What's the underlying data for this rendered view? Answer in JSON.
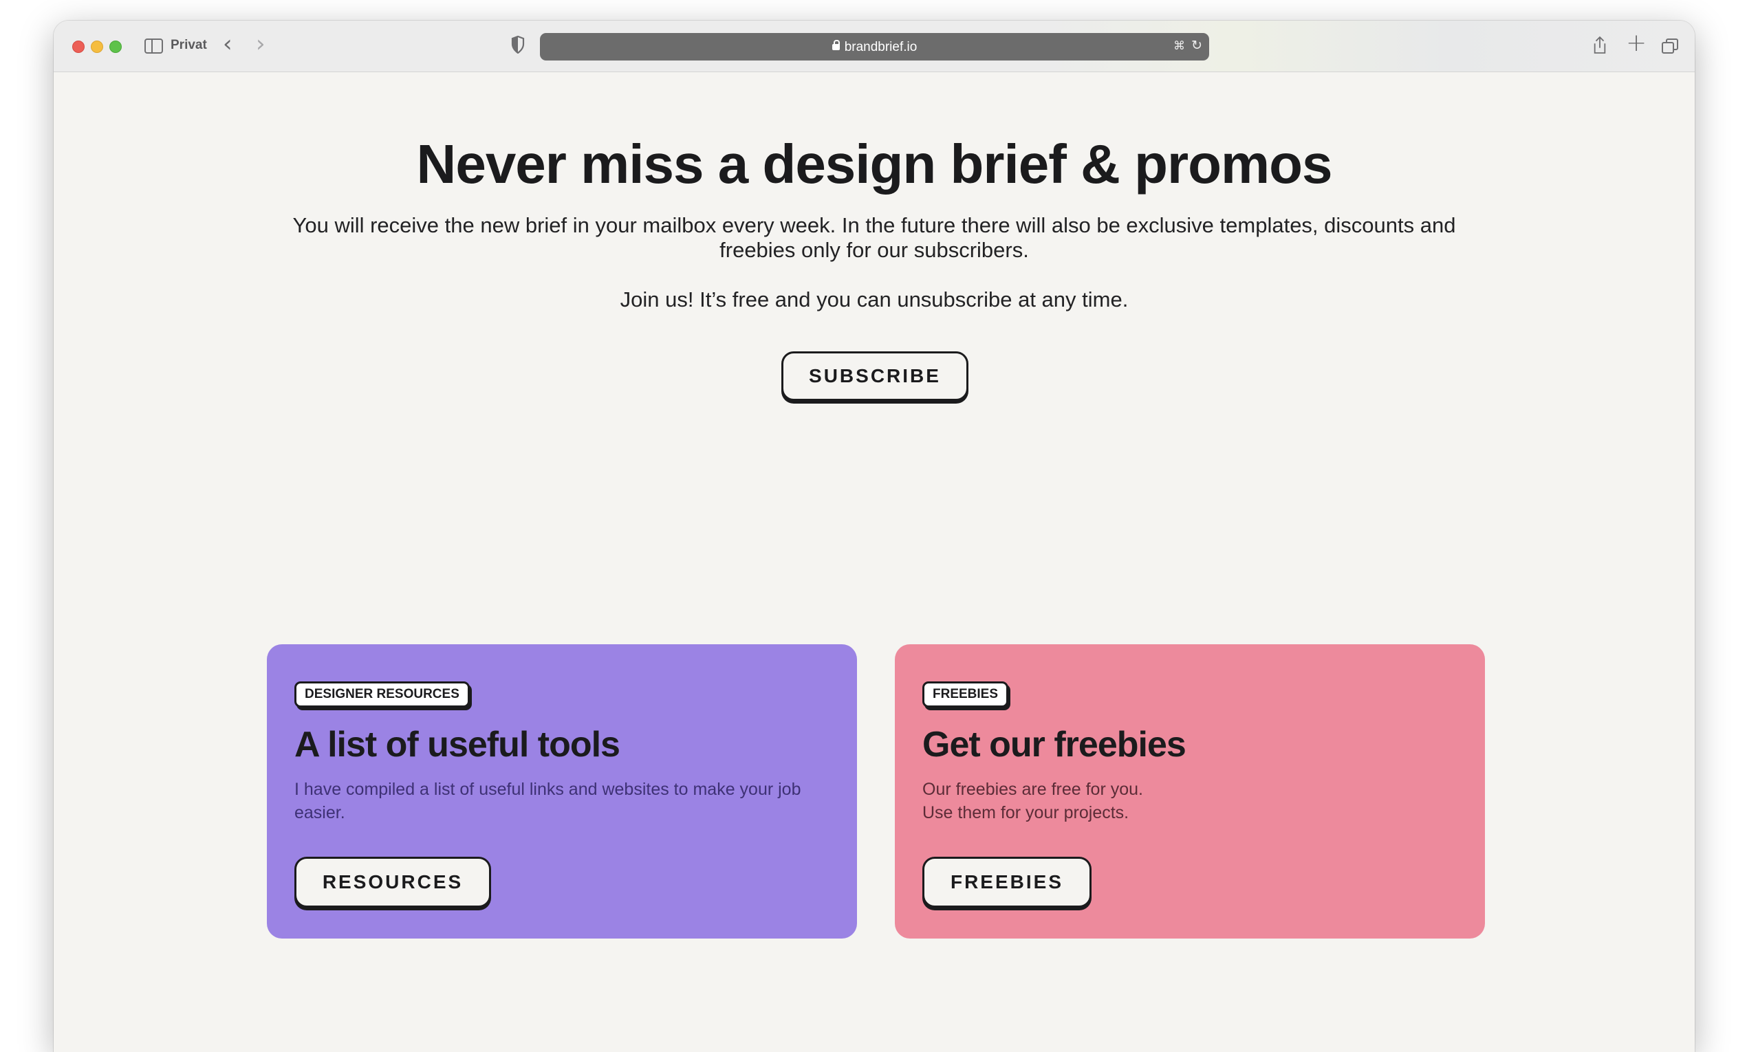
{
  "browser": {
    "sidebar_label": "Privat",
    "url": "brandbrief.io",
    "icons": {
      "sidebar": "sidebar-icon",
      "back": "chevron-left-icon",
      "forward": "chevron-right-icon",
      "privacy": "shield-icon",
      "lock": "lock-icon",
      "translate": "translate-icon",
      "reload": "reload-icon",
      "share": "share-icon",
      "new_tab": "plus-icon",
      "tabs": "tabs-overview-icon"
    }
  },
  "hero": {
    "title": "Never miss a design brief & promos",
    "subtitle": "You will receive the new brief in your mailbox every week. In the future there will also be exclusive templates, discounts and freebies only for our subscribers.",
    "join_text": "Join us! It’s free and you can unsubscribe at any time.",
    "subscribe_label": "SUBSCRIBE"
  },
  "cards": [
    {
      "badge": "DESIGNER RESOURCES",
      "title": "A list of useful tools",
      "description_lines": [
        "I have compiled a list of useful links and websites to make your job easier."
      ],
      "button_label": "RESOURCES",
      "color": "#9b83e4"
    },
    {
      "badge": "FREEBIES",
      "title": "Get our freebies",
      "description_lines": [
        "Our freebies are free for you.",
        "Use them for your projects."
      ],
      "button_label": "FREEBIES",
      "color": "#ed8a9c"
    }
  ],
  "colors": {
    "page_background": "#f5f4f1",
    "text_dark": "#1b1b1d"
  }
}
